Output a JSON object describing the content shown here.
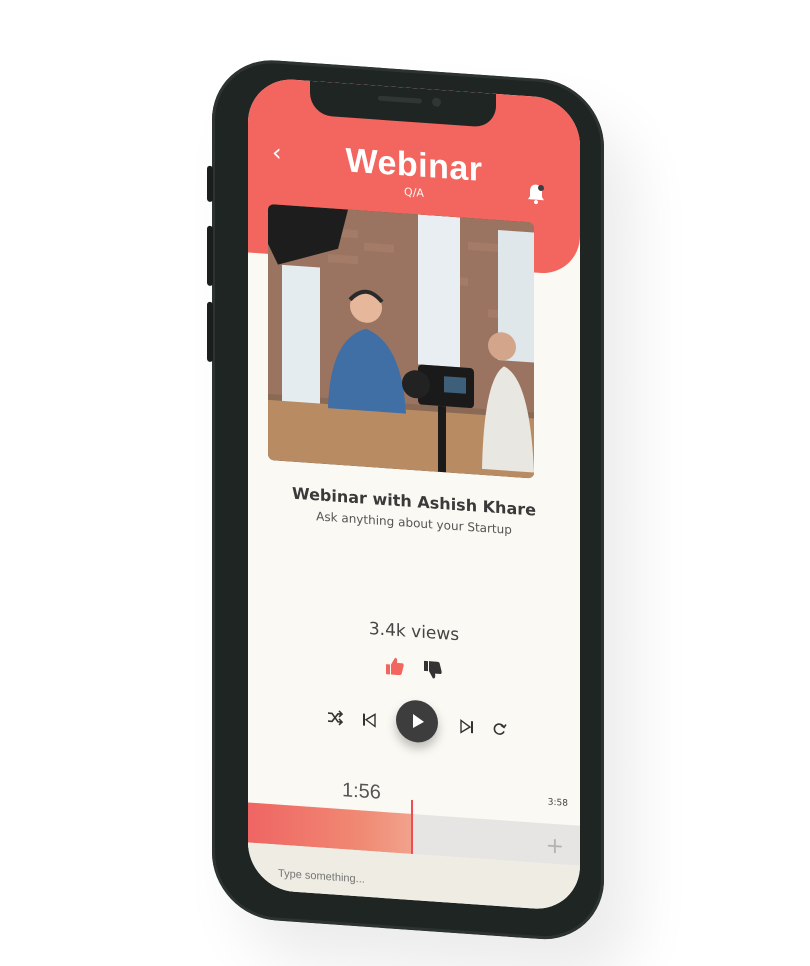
{
  "header": {
    "title": "Webinar",
    "subtitle": "Q/A",
    "back_icon": "chevron-left-icon",
    "notification_icon": "bell-icon"
  },
  "video": {
    "thumbnail": "podcast-studio-scene"
  },
  "talk": {
    "title": "Webinar with Ashish Khare",
    "subtitle": "Ask anything about your Startup",
    "views": "3.4k views"
  },
  "reactions": {
    "like_icon": "thumbs-up-icon",
    "dislike_icon": "thumbs-down-icon"
  },
  "player": {
    "current_time": "1:56",
    "total_time": "3:58",
    "progress": 0.49,
    "icons": [
      "shuffle-icon",
      "previous-icon",
      "play-icon",
      "next-icon",
      "repeat-icon"
    ]
  },
  "composer": {
    "placeholder": "Type something...",
    "add_icon": "plus-icon"
  },
  "colors": {
    "accent": "#f2665f",
    "background": "#fbf9f3",
    "phone_frame": "#1f2523"
  }
}
